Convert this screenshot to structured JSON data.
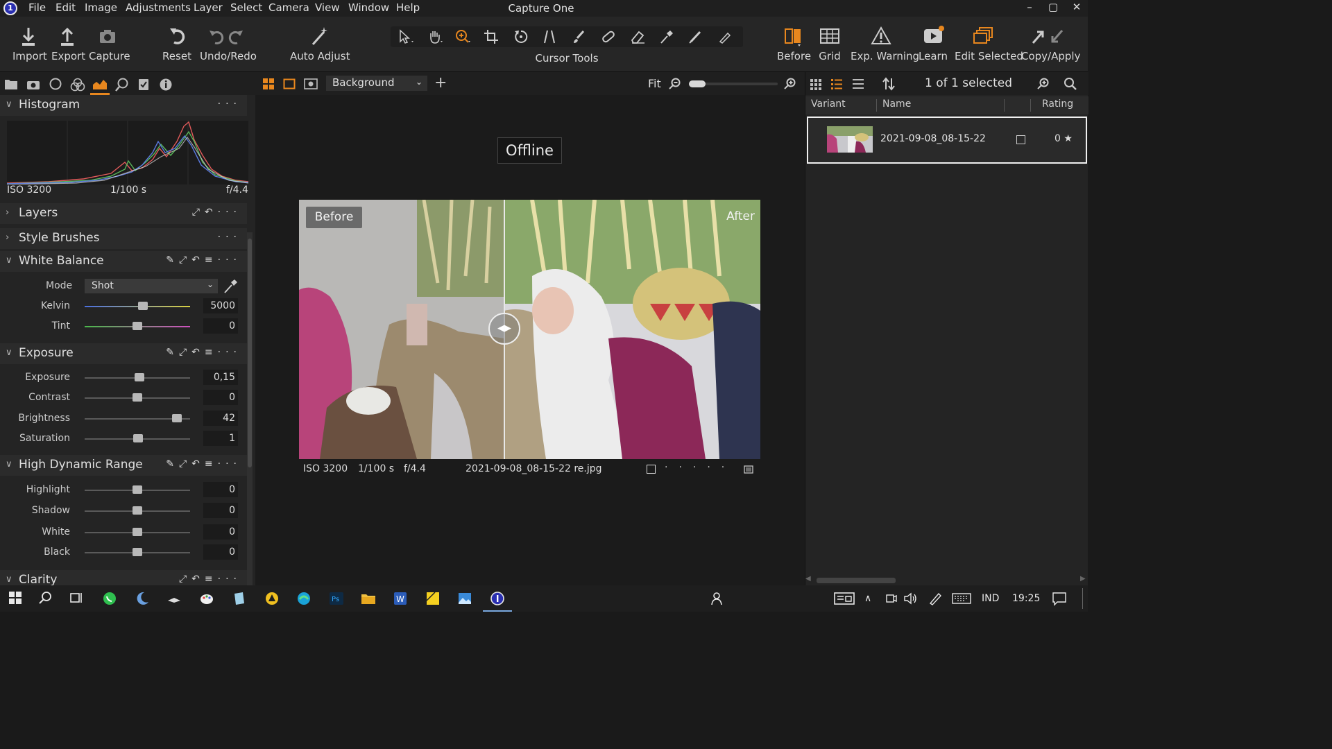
{
  "window": {
    "title": "Capture One",
    "logo": "1",
    "menu": [
      "File",
      "Edit",
      "Image",
      "Adjustments",
      "Layer",
      "Select",
      "Camera",
      "View",
      "Window",
      "Help"
    ]
  },
  "toolbar": {
    "import": "Import",
    "export": "Export",
    "capture": "Capture",
    "reset": "Reset",
    "undo_redo": "Undo/Redo",
    "auto_adjust": "Auto Adjust",
    "cursor_tools": "Cursor Tools",
    "before": "Before",
    "grid": "Grid",
    "exp_warning": "Exp. Warning",
    "learn": "Learn",
    "edit_selected": "Edit Selected",
    "copy_apply": "Copy/Apply"
  },
  "left_panel": {
    "histogram": {
      "title": "Histogram",
      "iso": "ISO 3200",
      "shutter": "1/100 s",
      "aperture": "f/4.4"
    },
    "layers": {
      "title": "Layers"
    },
    "style_brushes": {
      "title": "Style Brushes"
    },
    "white_balance": {
      "title": "White Balance",
      "mode_label": "Mode",
      "mode_value": "Shot",
      "kelvin_label": "Kelvin",
      "kelvin_value": "5000",
      "tint_label": "Tint",
      "tint_value": "0"
    },
    "exposure": {
      "title": "Exposure",
      "rows": [
        {
          "label": "Exposure",
          "value": "0,15"
        },
        {
          "label": "Contrast",
          "value": "0"
        },
        {
          "label": "Brightness",
          "value": "42"
        },
        {
          "label": "Saturation",
          "value": "1"
        }
      ]
    },
    "hdr": {
      "title": "High Dynamic Range",
      "rows": [
        {
          "label": "Highlight",
          "value": "0"
        },
        {
          "label": "Shadow",
          "value": "0"
        },
        {
          "label": "White",
          "value": "0"
        },
        {
          "label": "Black",
          "value": "0"
        }
      ]
    },
    "clarity": {
      "title": "Clarity"
    }
  },
  "viewer": {
    "style_layer": "Background",
    "zoom": "Fit",
    "offline": "Offline",
    "before_tag": "Before",
    "after_tag": "After",
    "iso": "ISO 3200",
    "shutter": "1/100 s",
    "aperture": "f/4.4",
    "filename": "2021-09-08_08-15-22 re.jpg"
  },
  "browser": {
    "selected_count": "1 of 1 selected",
    "columns": {
      "variant": "Variant",
      "name": "Name",
      "rating": "Rating"
    },
    "file": {
      "name": "2021-09-08_08-15-22",
      "rating": "0 ★"
    }
  },
  "taskbar": {
    "language": "IND",
    "time": "19:25"
  },
  "colors": {
    "accent": "#e8871e",
    "panel": "#242424",
    "background": "#1b1b1b"
  }
}
